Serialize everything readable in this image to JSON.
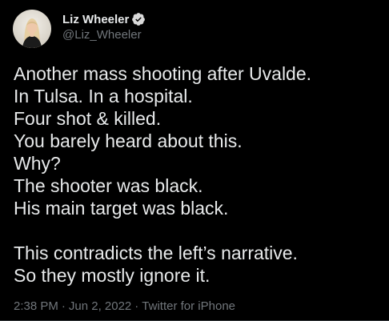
{
  "tweet": {
    "author": {
      "display_name": "Liz Wheeler",
      "handle": "@Liz_Wheeler",
      "avatar_icon": "profile-photo",
      "verified_icon": "verified-badge-icon"
    },
    "text_lines": [
      "Another mass shooting after Uvalde.",
      "In Tulsa. In a hospital.",
      "Four shot & killed.",
      "You barely heard about this.",
      "Why?",
      "The shooter was black.",
      "His main target was black.",
      "",
      "This contradicts the left’s narrative.",
      "So they mostly ignore it."
    ],
    "meta": {
      "time": "2:38 PM",
      "separator": "·",
      "date": "Jun 2, 2022",
      "source": "Twitter for iPhone"
    }
  },
  "colors": {
    "background": "#000000",
    "text_primary": "#e7e9ea",
    "text_secondary": "#71767b",
    "verified_badge": "#d9d9d9"
  }
}
